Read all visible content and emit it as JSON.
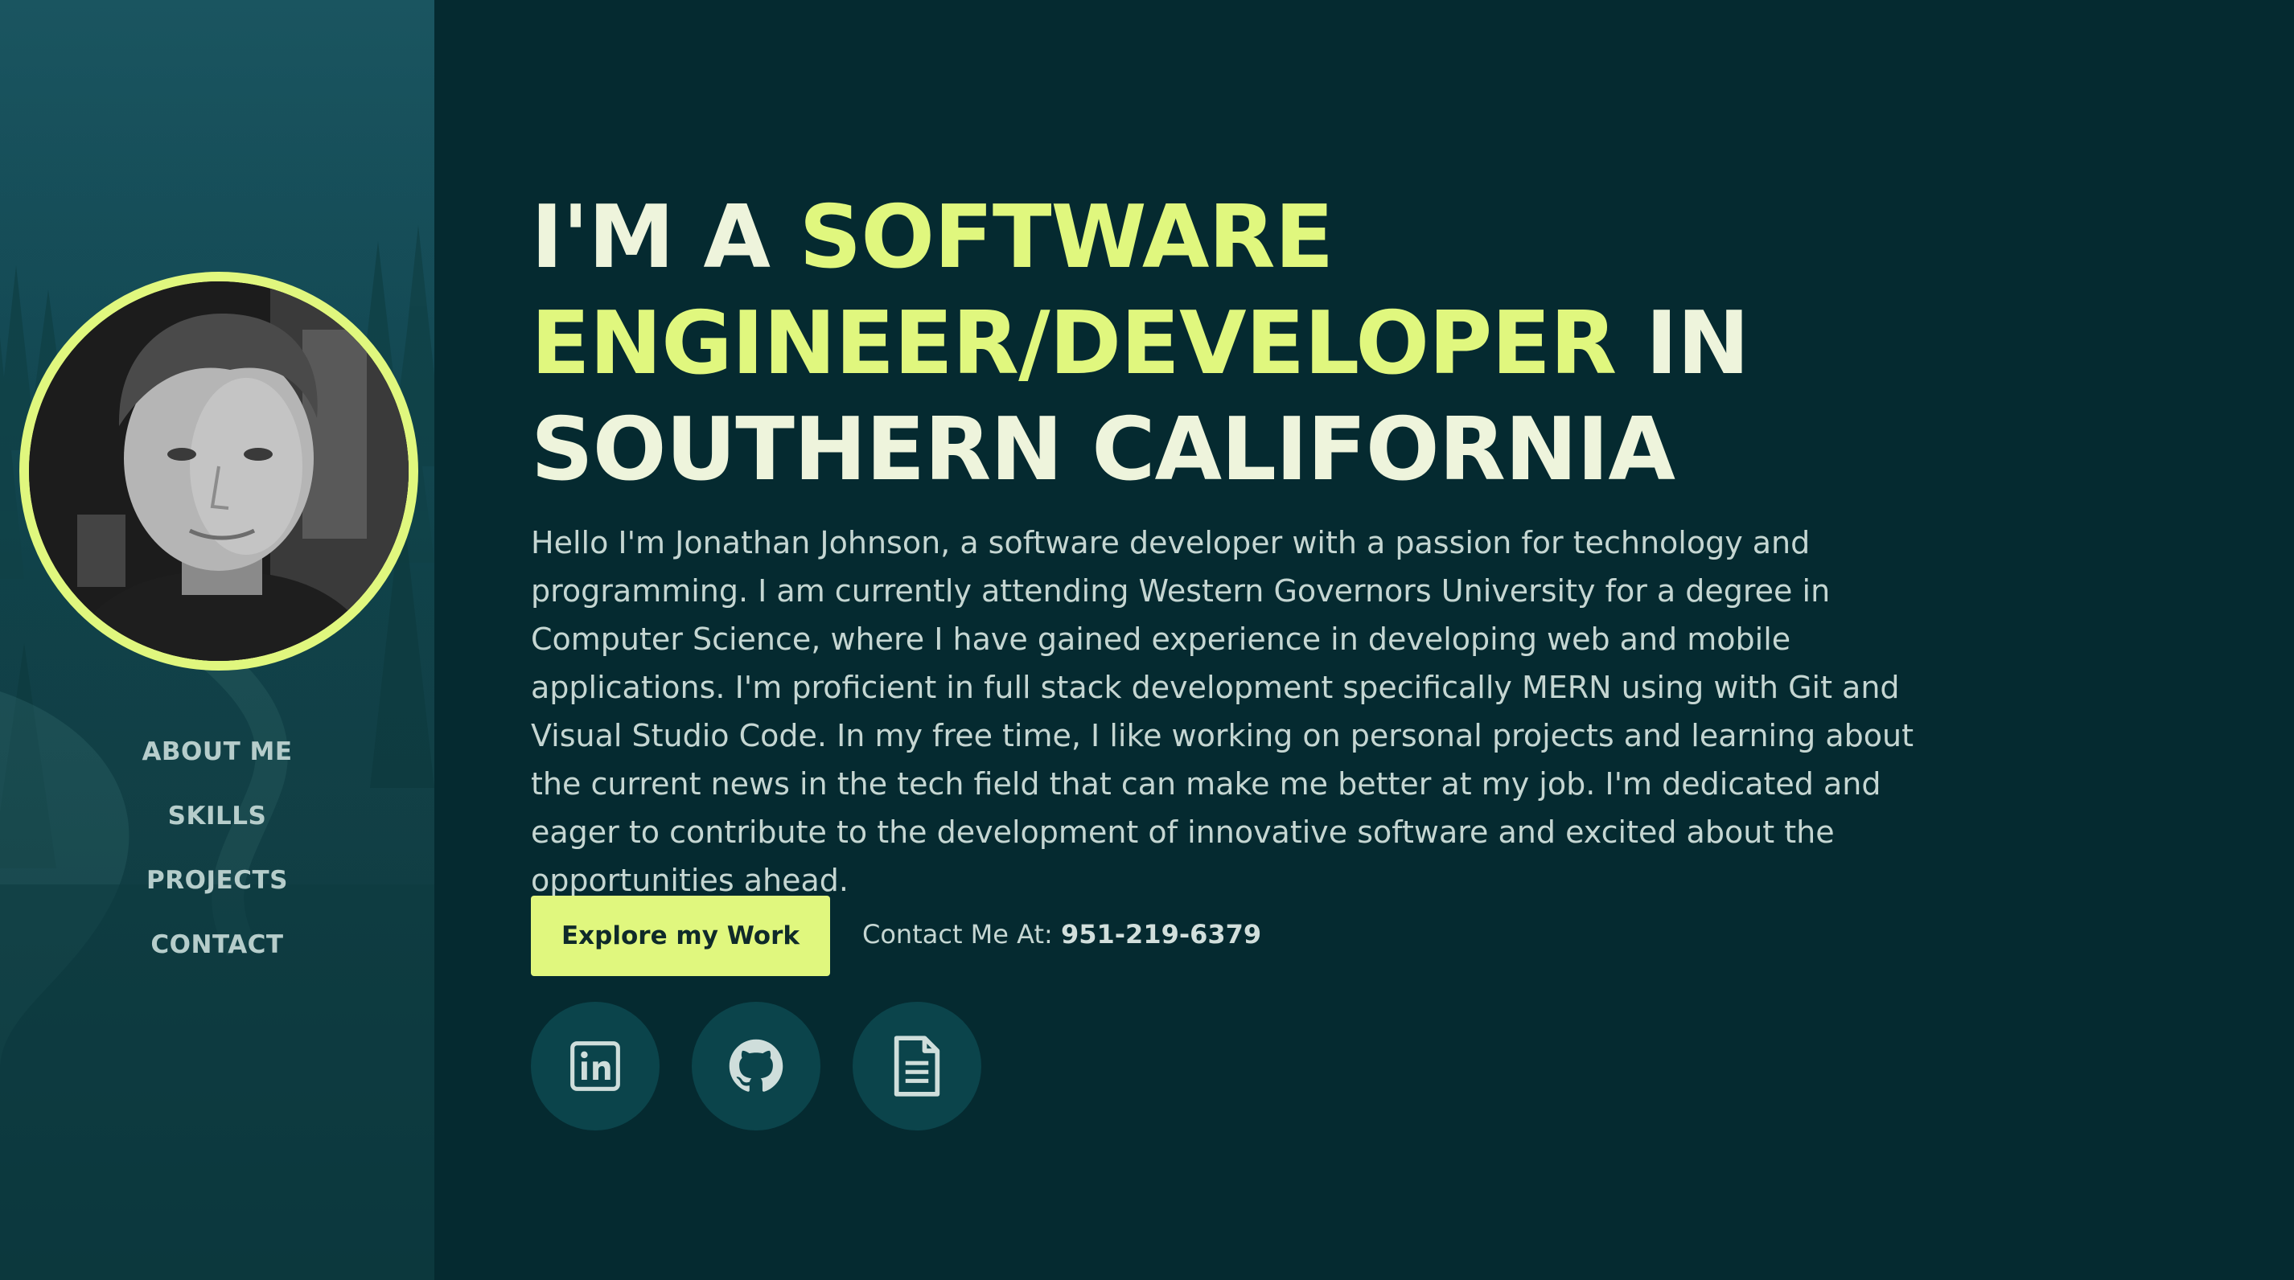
{
  "sidebar": {
    "avatar_alt": "Profile photo",
    "nav": [
      {
        "label": "ABOUT ME"
      },
      {
        "label": "SKILLS"
      },
      {
        "label": "PROJECTS"
      },
      {
        "label": "CONTACT"
      }
    ]
  },
  "hero": {
    "headline": {
      "part1": "I'M A ",
      "highlight": "SOFTWARE ENGINEER/DEVELOPER",
      "part2": " IN SOUTHERN CALIFORNIA"
    },
    "bio": "Hello I'm Jonathan Johnson, a software developer with a passion for technology and programming. I am currently attending Western Governors University for a degree in Computer Science, where I have gained experience in developing web and mobile applications. I'm proficient in full stack development specifically MERN using with Git and Visual Studio Code. In my free time, I like working on personal projects and learning about the current news in the tech field that can make me better at my job. I'm dedicated and eager to contribute to the development of innovative software and excited about the opportunities ahead.",
    "cta_label": "Explore my Work",
    "contact_prefix": "Contact Me At: ",
    "phone": "951-219-6379"
  },
  "socials": [
    {
      "icon": "linkedin-icon"
    },
    {
      "icon": "github-icon"
    },
    {
      "icon": "document-icon"
    }
  ],
  "colors": {
    "accent": "#e0f77e",
    "background": "#052a30",
    "sidebar": "#144a55",
    "headline_text": "#eef4dc",
    "body_text": "#c5d6d2",
    "social_bg": "#0b444b"
  }
}
